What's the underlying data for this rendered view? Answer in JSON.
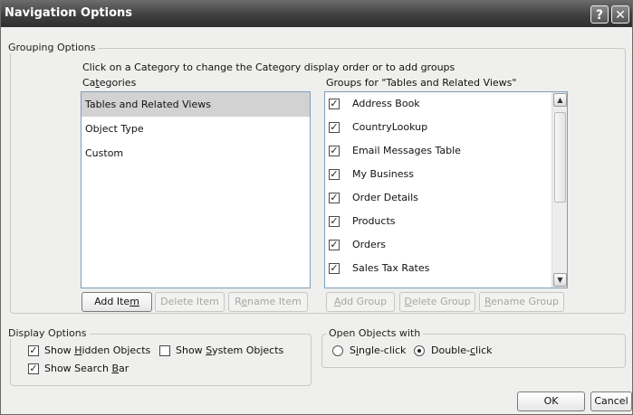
{
  "window": {
    "title": "Navigation Options",
    "help_label": "?",
    "close_label": "✕"
  },
  "grouping": {
    "legend": "Grouping Options",
    "instruction": "Click on a Category to change the Category display order or to add groups",
    "categories_header": "Categories",
    "groups_header": "Groups for \"Tables and Related Views\"",
    "categories": [
      {
        "label": "Tables and Related Views",
        "selected": true
      },
      {
        "label": "Object Type",
        "selected": false
      },
      {
        "label": "Custom",
        "selected": false
      }
    ],
    "groups": [
      {
        "label": "Address Book",
        "checked": true
      },
      {
        "label": "CountryLookup",
        "checked": true
      },
      {
        "label": "Email Messages Table",
        "checked": true
      },
      {
        "label": "My Business",
        "checked": true
      },
      {
        "label": "Order Details",
        "checked": true
      },
      {
        "label": "Products",
        "checked": true
      },
      {
        "label": "Orders",
        "checked": true
      },
      {
        "label": "Sales Tax Rates",
        "checked": true
      }
    ],
    "buttons": {
      "add_item": "Add Item",
      "delete_item": "Delete Item",
      "rename_item": "Rename Item",
      "add_group": "Add Group",
      "delete_group": "Delete Group",
      "rename_group": "Rename Group"
    }
  },
  "display": {
    "legend": "Display Options",
    "show_hidden": {
      "label": "Show Hidden Objects",
      "checked": true
    },
    "show_system": {
      "label": "Show System Objects",
      "checked": false
    },
    "show_search": {
      "label": "Show Search Bar",
      "checked": true
    }
  },
  "open_objects": {
    "legend": "Open Objects with",
    "single_click": {
      "label": "Single-click",
      "selected": false
    },
    "double_click": {
      "label": "Double-click",
      "selected": true
    }
  },
  "footer": {
    "ok": "OK",
    "cancel": "Cancel"
  }
}
